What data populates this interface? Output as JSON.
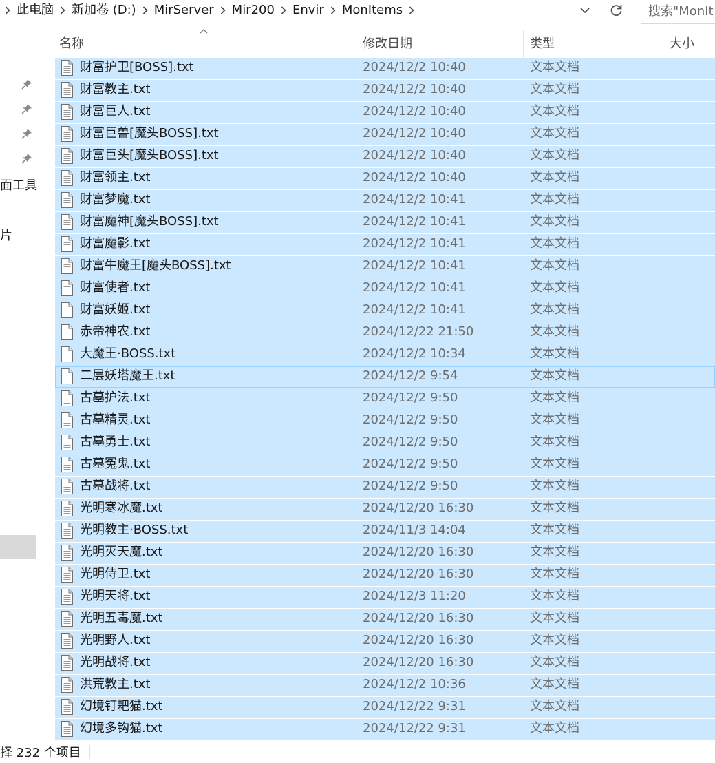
{
  "breadcrumb": {
    "items": [
      "此电脑",
      "新加卷 (D:)",
      "MirServer",
      "Mir200",
      "Envir",
      "MonItems"
    ]
  },
  "search": {
    "placeholder": "搜索\"MonIt"
  },
  "nav": {
    "labels": [
      "面工具",
      "片"
    ]
  },
  "columns": {
    "name": "名称",
    "date": "修改日期",
    "type": "类型",
    "size": "大小"
  },
  "files": [
    {
      "name": "财富护卫[BOSS].txt",
      "date": "2024/12/2 10:40",
      "type": "文本文档"
    },
    {
      "name": "财富教主.txt",
      "date": "2024/12/2 10:40",
      "type": "文本文档"
    },
    {
      "name": "财富巨人.txt",
      "date": "2024/12/2 10:40",
      "type": "文本文档"
    },
    {
      "name": "财富巨兽[魔头BOSS].txt",
      "date": "2024/12/2 10:40",
      "type": "文本文档"
    },
    {
      "name": "财富巨头[魔头BOSS].txt",
      "date": "2024/12/2 10:40",
      "type": "文本文档"
    },
    {
      "name": "财富领主.txt",
      "date": "2024/12/2 10:40",
      "type": "文本文档"
    },
    {
      "name": "财富梦魔.txt",
      "date": "2024/12/2 10:41",
      "type": "文本文档"
    },
    {
      "name": "财富魔神[魔头BOSS].txt",
      "date": "2024/12/2 10:41",
      "type": "文本文档"
    },
    {
      "name": "财富魔影.txt",
      "date": "2024/12/2 10:41",
      "type": "文本文档"
    },
    {
      "name": "财富牛魔王[魔头BOSS].txt",
      "date": "2024/12/2 10:41",
      "type": "文本文档"
    },
    {
      "name": "财富使者.txt",
      "date": "2024/12/2 10:41",
      "type": "文本文档"
    },
    {
      "name": "财富妖姬.txt",
      "date": "2024/12/2 10:41",
      "type": "文本文档"
    },
    {
      "name": "赤帝神农.txt",
      "date": "2024/12/22 21:50",
      "type": "文本文档"
    },
    {
      "name": "大魔王·BOSS.txt",
      "date": "2024/12/2 10:34",
      "type": "文本文档"
    },
    {
      "name": "二层妖塔魔王.txt",
      "date": "2024/12/2 9:54",
      "type": "文本文档"
    },
    {
      "name": "古墓护法.txt",
      "date": "2024/12/2 9:50",
      "type": "文本文档"
    },
    {
      "name": "古墓精灵.txt",
      "date": "2024/12/2 9:50",
      "type": "文本文档"
    },
    {
      "name": "古墓勇士.txt",
      "date": "2024/12/2 9:50",
      "type": "文本文档"
    },
    {
      "name": "古墓冤鬼.txt",
      "date": "2024/12/2 9:50",
      "type": "文本文档"
    },
    {
      "name": "古墓战将.txt",
      "date": "2024/12/2 9:50",
      "type": "文本文档"
    },
    {
      "name": "光明寒冰魔.txt",
      "date": "2024/12/20 16:30",
      "type": "文本文档"
    },
    {
      "name": "光明教主·BOSS.txt",
      "date": "2024/11/3 14:04",
      "type": "文本文档"
    },
    {
      "name": "光明灭天魔.txt",
      "date": "2024/12/20 16:30",
      "type": "文本文档"
    },
    {
      "name": "光明侍卫.txt",
      "date": "2024/12/20 16:30",
      "type": "文本文档"
    },
    {
      "name": "光明天将.txt",
      "date": "2024/12/3 11:20",
      "type": "文本文档"
    },
    {
      "name": "光明五毒魔.txt",
      "date": "2024/12/20 16:30",
      "type": "文本文档"
    },
    {
      "name": "光明野人.txt",
      "date": "2024/12/20 16:30",
      "type": "文本文档"
    },
    {
      "name": "光明战将.txt",
      "date": "2024/12/20 16:30",
      "type": "文本文档"
    },
    {
      "name": "洪荒教主.txt",
      "date": "2024/12/2 10:36",
      "type": "文本文档"
    },
    {
      "name": "幻境钉耙猫.txt",
      "date": "2024/12/22 9:31",
      "type": "文本文档"
    },
    {
      "name": "幻境多钩猫.txt",
      "date": "2024/12/22 9:31",
      "type": "文本文档"
    }
  ],
  "status": {
    "text": "择 232 个项目"
  },
  "colors": {
    "selection": "#cce8ff",
    "focus_border": "#99d1ff",
    "nav_selected": "#d9d9d9"
  },
  "icons": [
    "chevron-right-icon",
    "chevron-down-icon",
    "refresh-icon",
    "pin-icon",
    "text-file-icon",
    "sort-up-icon"
  ]
}
